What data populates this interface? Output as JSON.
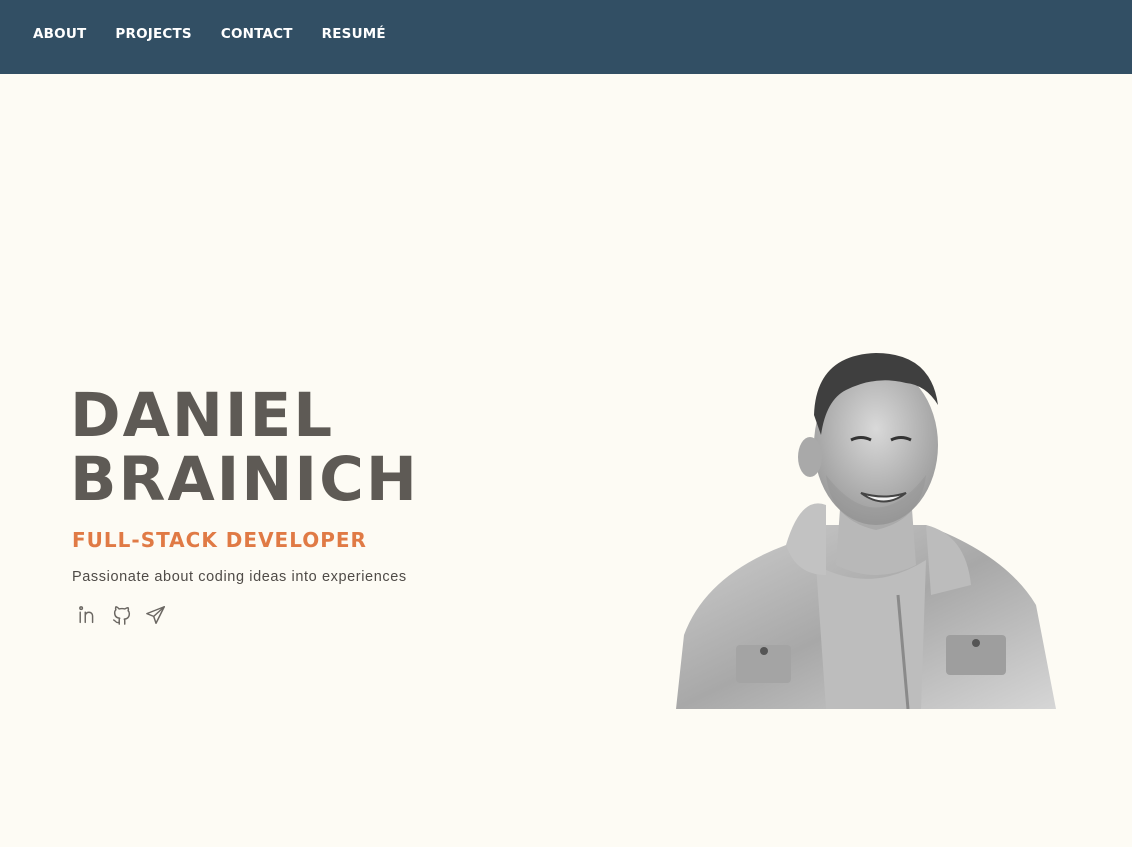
{
  "nav": {
    "items": [
      {
        "label": "ABOUT"
      },
      {
        "label": "PROJECTS"
      },
      {
        "label": "CONTACT"
      },
      {
        "label": "RESUMÉ"
      }
    ]
  },
  "hero": {
    "name_line1": "DANIEL",
    "name_line2": "BRAINICH",
    "role": "FULL-STACK DEVELOPER",
    "tagline": "Passionate about coding ideas into experiences",
    "social": [
      {
        "icon": "linkedin-icon"
      },
      {
        "icon": "github-icon"
      },
      {
        "icon": "paper-plane-icon"
      }
    ]
  },
  "colors": {
    "navbar": "#324f64",
    "background": "#fdfbf4",
    "name": "#5e5a55",
    "accent": "#e07a45"
  }
}
